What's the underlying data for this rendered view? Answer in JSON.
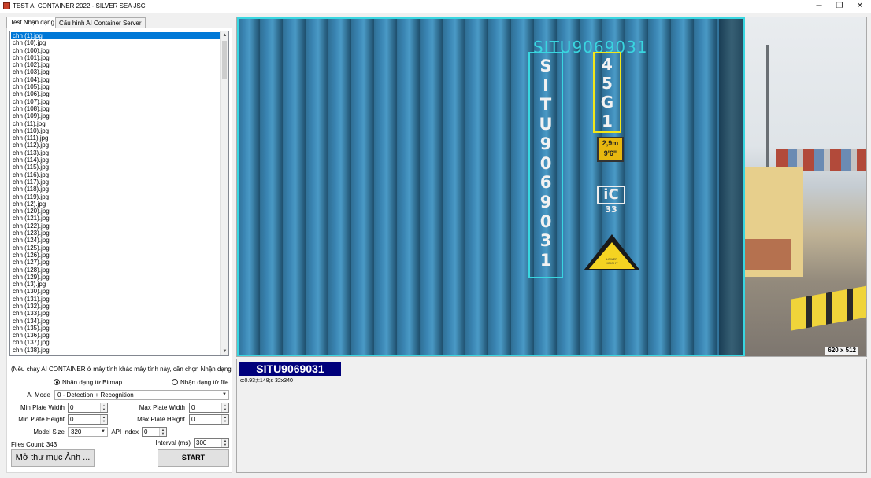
{
  "window": {
    "title": "TEST AI CONTAINER 2022 - SILVER SEA JSC",
    "minimize_glyph": "─",
    "restore_glyph": "❐",
    "close_glyph": "✕"
  },
  "tabs": [
    {
      "label": "Test Nhận dạng",
      "active": true
    },
    {
      "label": "Cấu hình AI Container Server",
      "active": false
    }
  ],
  "file_list": {
    "selected": "chh (1).jpg",
    "items": [
      "chh (1).jpg",
      "chh (10).jpg",
      "chh (100).jpg",
      "chh (101).jpg",
      "chh (102).jpg",
      "chh (103).jpg",
      "chh (104).jpg",
      "chh (105).jpg",
      "chh (106).jpg",
      "chh (107).jpg",
      "chh (108).jpg",
      "chh (109).jpg",
      "chh (11).jpg",
      "chh (110).jpg",
      "chh (111).jpg",
      "chh (112).jpg",
      "chh (113).jpg",
      "chh (114).jpg",
      "chh (115).jpg",
      "chh (116).jpg",
      "chh (117).jpg",
      "chh (118).jpg",
      "chh (119).jpg",
      "chh (12).jpg",
      "chh (120).jpg",
      "chh (121).jpg",
      "chh (122).jpg",
      "chh (123).jpg",
      "chh (124).jpg",
      "chh (125).jpg",
      "chh (126).jpg",
      "chh (127).jpg",
      "chh (128).jpg",
      "chh (129).jpg",
      "chh (13).jpg",
      "chh (130).jpg",
      "chh (131).jpg",
      "chh (132).jpg",
      "chh (133).jpg",
      "chh (134).jpg",
      "chh (135).jpg",
      "chh (136).jpg",
      "chh (137).jpg",
      "chh (138).jpg"
    ]
  },
  "controls": {
    "note": "(Nếu chạy AI CONTAINER ở máy tính khác máy tính này, cần chọn Nhận dạng từ Bi",
    "radio_bitmap": "Nhận dạng từ Bitmap",
    "radio_file": "Nhận dạng từ file",
    "ai_mode_label": "AI Mode",
    "ai_mode_value": "0 - Detection + Recognition",
    "min_plate_width_label": "Min Plate Width",
    "min_plate_width_value": "0",
    "max_plate_width_label": "Max Plate Width",
    "max_plate_width_value": "0",
    "min_plate_height_label": "Min Plate Height",
    "min_plate_height_value": "0",
    "max_plate_height_label": "Max Plate Height",
    "max_plate_height_value": "0",
    "model_size_label": "Model Size",
    "model_size_value": "320",
    "api_index_label": "API Index",
    "api_index_value": "0",
    "interval_label": "Interval (ms)",
    "interval_value": "300",
    "files_count": "Files Count: 343",
    "open_folder_button": "Mở thư mục Ảnh ...",
    "start_button": "START"
  },
  "image_view": {
    "detected_text_overlay": "SITU9069031",
    "vertical_code_chars": [
      "S",
      "I",
      "T",
      "U",
      "9",
      "0",
      "6",
      "9",
      "0",
      "3",
      "1"
    ],
    "type_code_chars": [
      "4",
      "5",
      "G",
      "1"
    ],
    "size_plate_line1": "2,9m",
    "size_plate_line2": "9'6\"",
    "ic_mark_top": "iC",
    "ic_mark_bottom": "33",
    "hazard_text": "LOWER HEIGHT",
    "dimensions": "620 x 512"
  },
  "result": {
    "plate": "SITU9069031",
    "meta": "c:0.93;t:148;s 32x340"
  },
  "colors": {
    "detection_box": "#39d6e0",
    "type_box": "#f2e61a",
    "plate_bg": "#00007b",
    "selection": "#0078d7"
  }
}
